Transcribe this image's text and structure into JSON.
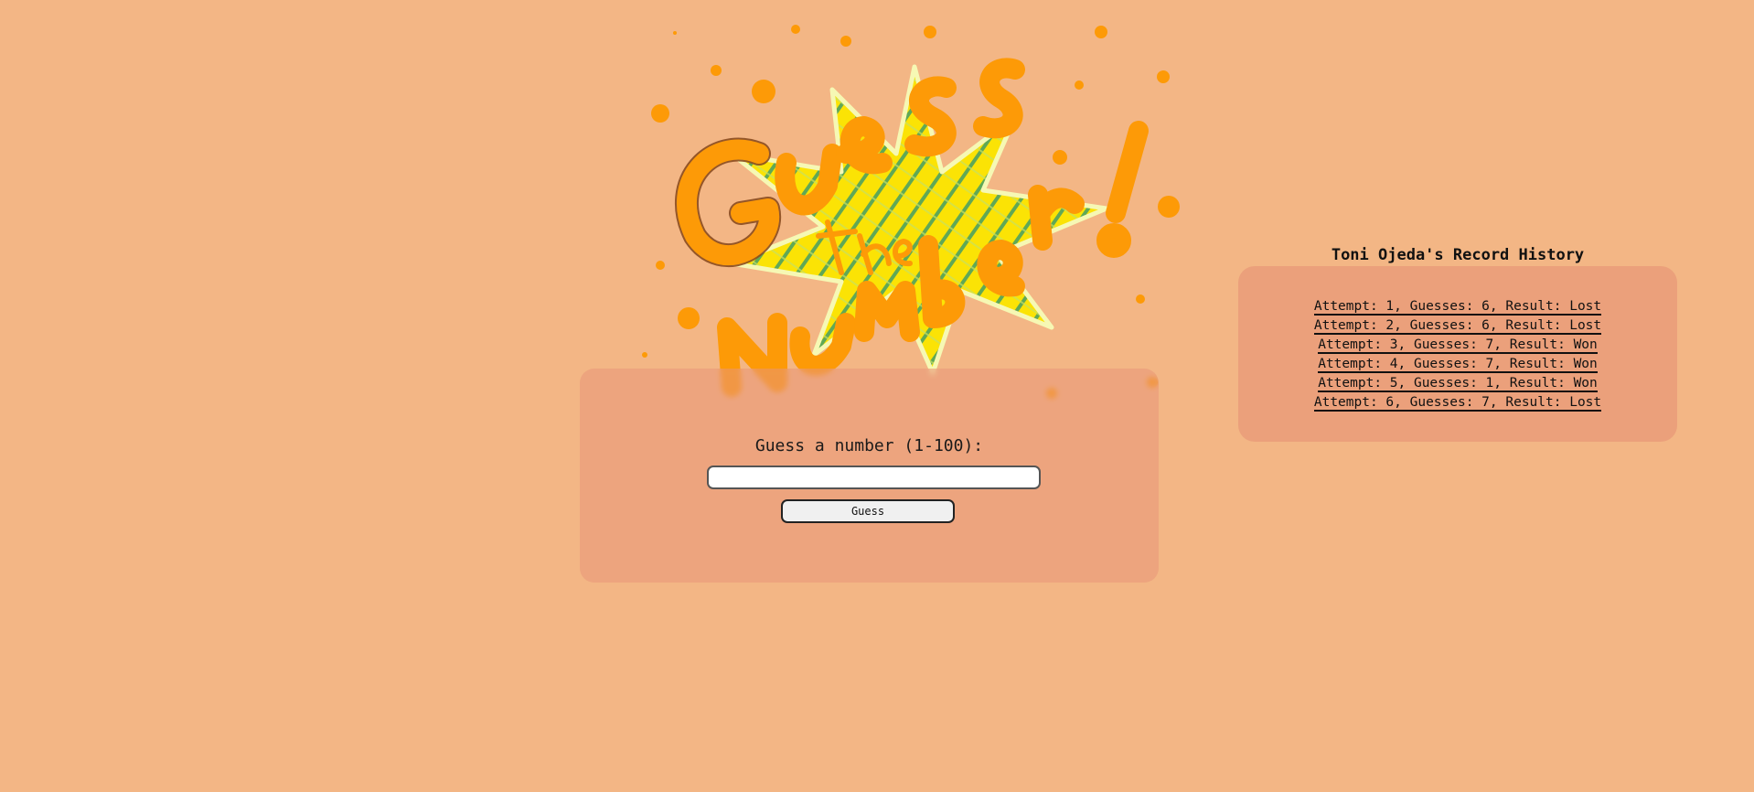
{
  "logo": {
    "alt": "Guess the Number!",
    "colors": {
      "letters": "#fd9a07",
      "outline": "#8a4b1f",
      "burst": "#fbe305",
      "plaid": "#3a9a6a",
      "highlight": "#f6f8b4"
    }
  },
  "game": {
    "prompt": "Guess a number (1-100):",
    "input_value": "",
    "input_placeholder": "",
    "button_label": "Guess"
  },
  "history": {
    "title": "Toni Ojeda's Record History",
    "records": [
      "Attempt: 1, Guesses: 6, Result: Lost",
      "Attempt: 2, Guesses: 6, Result: Lost",
      "Attempt: 3, Guesses: 7, Result: Won",
      "Attempt: 4, Guesses: 7, Result: Won",
      "Attempt: 5, Guesses: 1, Result: Won",
      "Attempt: 6, Guesses: 7, Result: Lost"
    ]
  },
  "theme": {
    "background": "#f3b685",
    "card": "#eba07b"
  }
}
